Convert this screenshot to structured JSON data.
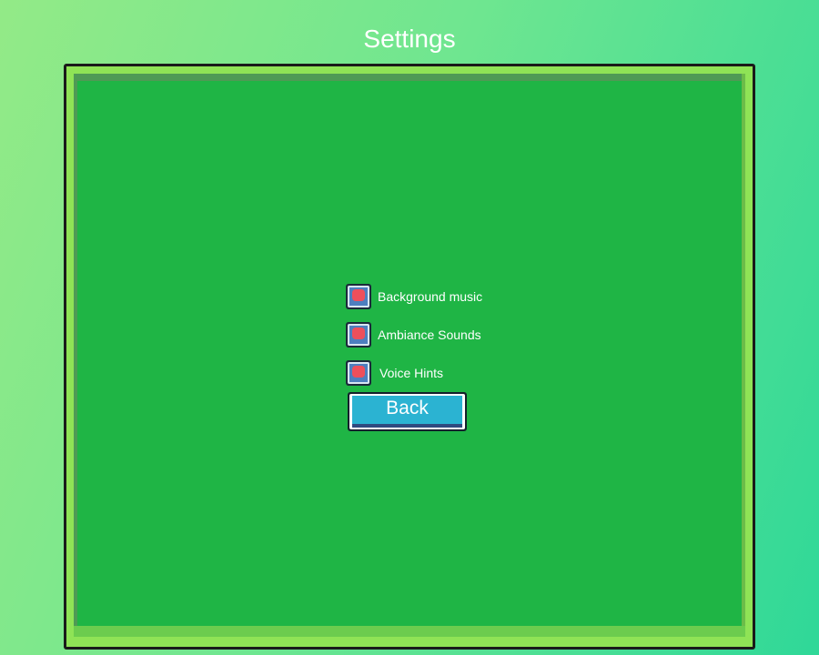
{
  "screen": {
    "title": "Settings"
  },
  "options": [
    {
      "label": "Background music",
      "checked": true
    },
    {
      "label": "Ambiance Sounds",
      "checked": true
    },
    {
      "label": "Voice Hints",
      "checked": true
    }
  ],
  "buttons": {
    "back_label": "Back"
  },
  "colors": {
    "panel_green": "#1fb545",
    "frame_light_green": "#8fe356",
    "checkbox_blue": "#4d7fbf",
    "checkbox_mark_red": "#ee4f5b",
    "button_cyan": "#2bb3d2"
  }
}
